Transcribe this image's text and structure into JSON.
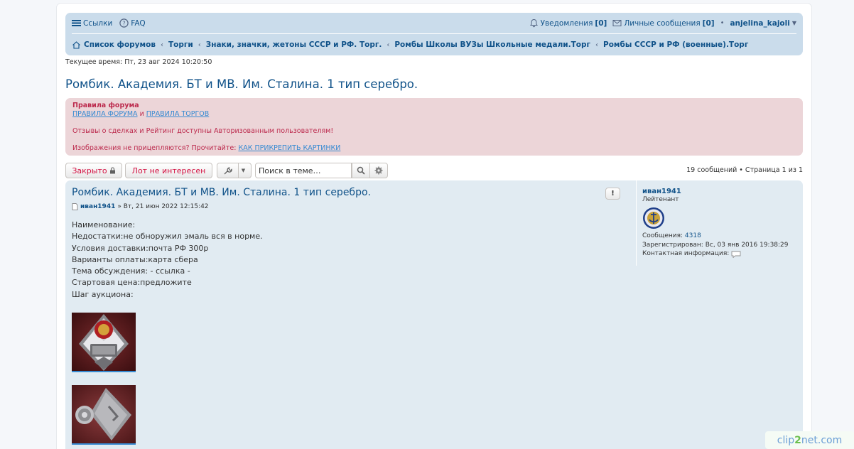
{
  "nav": {
    "links": "Ссылки",
    "faq": "FAQ",
    "notifications": "Уведомления",
    "notifications_count": "[0]",
    "messages": "Личные сообщения",
    "messages_count": "[0]",
    "bullet": "•",
    "username": "anjelina_kajoli"
  },
  "breadcrumbs": [
    "Список форумов",
    "Торги",
    "Знаки, значки, жетоны СССР и РФ. Торг.",
    "Ромбы Школы ВУЗы Школьные медали.Торг",
    "Ромбы СССР и РФ (военные).Торг"
  ],
  "current_time": "Текущее время: Пт, 23 авг 2024 10:20:50",
  "topic_title": "Ромбик. Академия. БТ и МВ. Им. Сталина. 1 тип серебро.",
  "rules": {
    "title": "Правила форума",
    "link1": "ПРАВИЛА ФОРУМА",
    "and": "и",
    "link2": "ПРАВИЛА ТОРГОВ",
    "line1": "Отзывы о сделках и Рейтинг доступны Авторизованным пользователям!",
    "line2_text": "Изображения не прицепляются? Прочитайте:",
    "line2_link": "КАК ПРИКРЕПИТЬ КАРТИНКИ"
  },
  "actions": {
    "closed": "Закрыто",
    "not_interested": "Лот не интересен",
    "search_placeholder": "Поиск в теме…",
    "pagination": "19 сообщений • Страница 1 из 1"
  },
  "post": {
    "title": "Ромбик. Академия. БТ и МВ. Им. Сталина. 1 тип серебро.",
    "report": "!",
    "author": "иван1941",
    "date": "» Вт, 21 июн 2022 12:15:42",
    "body": [
      "Наименование:",
      "Недостатки:не обноружил эмаль вся в норме.",
      "Условия доставки:почта РФ 300р",
      "Варианты оплаты:карта сбера",
      "Тема обсуждения: - ссылка -",
      "Стартовая цена:предложите",
      "Шаг аукциона:"
    ]
  },
  "profile": {
    "name": "иван1941",
    "rank": "Лейтенант",
    "posts_label": "Сообщения:",
    "posts_value": "4318",
    "registered_label": "Зарегистрирован:",
    "registered_value": "Вс, 03 янв 2016 19:38:29",
    "contact_label": "Контактная информация:"
  },
  "watermark": {
    "part1": "clip",
    "part2": "2",
    "part3": "net.com"
  }
}
